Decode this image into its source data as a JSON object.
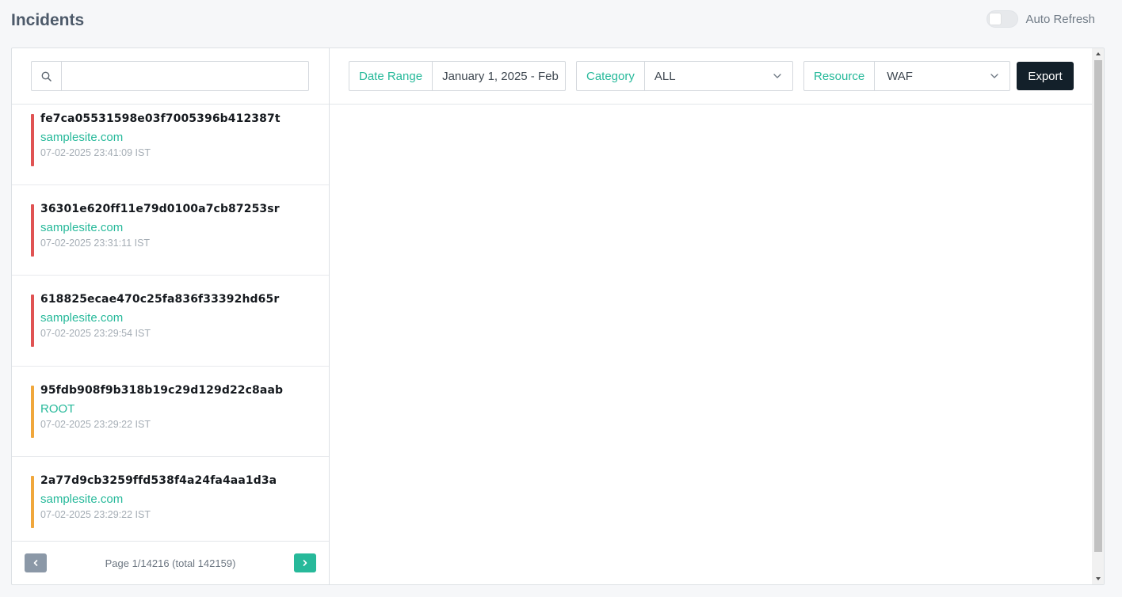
{
  "page": {
    "title": "Incidents"
  },
  "auto_refresh": {
    "label": "Auto Refresh",
    "enabled": false
  },
  "search": {
    "placeholder": "",
    "value": ""
  },
  "incidents": [
    {
      "id": "fe7ca05531598e03f7005396b412387t",
      "site": "samplesite.com",
      "time": "07-02-2025 23:41:09 IST",
      "severity_color": "#e05353"
    },
    {
      "id": "36301e620ff11e79d0100a7cb87253sr",
      "site": "samplesite.com",
      "time": "07-02-2025 23:31:11 IST",
      "severity_color": "#e05353"
    },
    {
      "id": "618825ecae470c25fa836f33392hd65r",
      "site": "samplesite.com",
      "time": "07-02-2025 23:29:54 IST",
      "severity_color": "#e05353"
    },
    {
      "id": "95fdb908f9b318b19c29d129d22c8aab",
      "site": "ROOT",
      "time": "07-02-2025 23:29:22 IST",
      "severity_color": "#f0a73c"
    },
    {
      "id": "2a77d9cb3259ffd538f4a24fa4aa1d3a",
      "site": "samplesite.com",
      "time": "07-02-2025 23:29:22 IST",
      "severity_color": "#f0a73c"
    }
  ],
  "pager": {
    "text": "Page 1/14216 (total 142159)"
  },
  "filters": {
    "date_range": {
      "label": "Date Range",
      "value": "January 1, 2025 - Feb"
    },
    "category": {
      "label": "Category",
      "value": "ALL"
    },
    "resource": {
      "label": "Resource",
      "value": "WAF"
    }
  },
  "toolbar": {
    "export_label": "Export"
  },
  "colors": {
    "accent": "#26b99a",
    "dark_button": "#13202a",
    "title": "#4d5a6a"
  }
}
